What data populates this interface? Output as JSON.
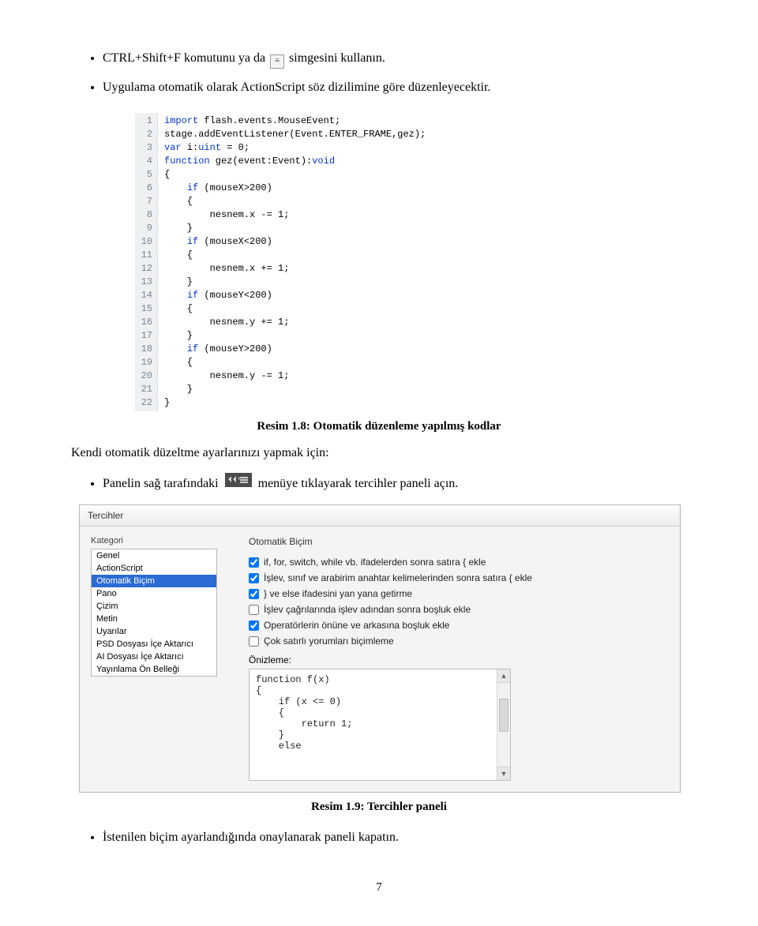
{
  "bullets": {
    "b1_part1": "CTRL+Shift+F komutunu ya da",
    "b1_part2": "simgesini kullanın.",
    "b2": "Uygulama otomatik olarak ActionScript söz dizilimine göre düzenleyecektir.",
    "b3_part1": "Panelin sağ tarafındaki",
    "b3_part2": "menüye tıklayarak tercihler paneli açın.",
    "b4": "İstenilen biçim ayarlandığında onaylanarak paneli kapatın."
  },
  "captions": {
    "c1": "Resim 1.8: Otomatik düzenleme yapılmış kodlar",
    "c2": "Resim 1.9: Tercihler paneli"
  },
  "paragraph1": "Kendi otomatik düzeltme ayarlarınızı yapmak için:",
  "code": {
    "lines": [
      "import flash.events.MouseEvent;",
      "stage.addEventListener(Event.ENTER_FRAME,gez);",
      "var i:uint = 0;",
      "function gez(event:Event):void",
      "{",
      "    if (mouseX>200)",
      "    {",
      "        nesnem.x -= 1;",
      "    }",
      "    if (mouseX<200)",
      "    {",
      "        nesnem.x += 1;",
      "    }",
      "    if (mouseY<200)",
      "    {",
      "        nesnem.y += 1;",
      "    }",
      "    if (mouseY>200)",
      "    {",
      "        nesnem.y -= 1;",
      "    }",
      "}"
    ]
  },
  "prefs": {
    "title": "Tercihler",
    "cat_label": "Kategori",
    "section_title": "Otomatik Biçim",
    "categories": [
      "Genel",
      "ActionScript",
      "Otomatik Biçim",
      "Pano",
      "Çizim",
      "Metin",
      "Uyarılar",
      "PSD Dosyası İçe Aktarıcı",
      "AI Dosyası İçe Aktarıcı",
      "Yayınlama Ön Belleği"
    ],
    "selected_index": 2,
    "checks": [
      {
        "checked": true,
        "label": "if, for, switch, while vb. ifadelerden sonra satıra { ekle"
      },
      {
        "checked": true,
        "label": "İşlev, sınıf ve arabirim anahtar kelimelerinden sonra satıra { ekle"
      },
      {
        "checked": true,
        "label": "} ve else ifadesini yan yana getirme"
      },
      {
        "checked": false,
        "label": "İşlev çağrılarında işlev adından sonra boşluk ekle"
      },
      {
        "checked": true,
        "label": "Operatörlerin önüne ve arkasına boşluk ekle"
      },
      {
        "checked": false,
        "label": "Çok satırlı yorumları biçimleme"
      }
    ],
    "preview_label": "Önizleme:",
    "preview_code": "function f(x)\n{\n    if (x <= 0)\n    {\n        return 1;\n    }\n    else"
  },
  "page_number": "7"
}
